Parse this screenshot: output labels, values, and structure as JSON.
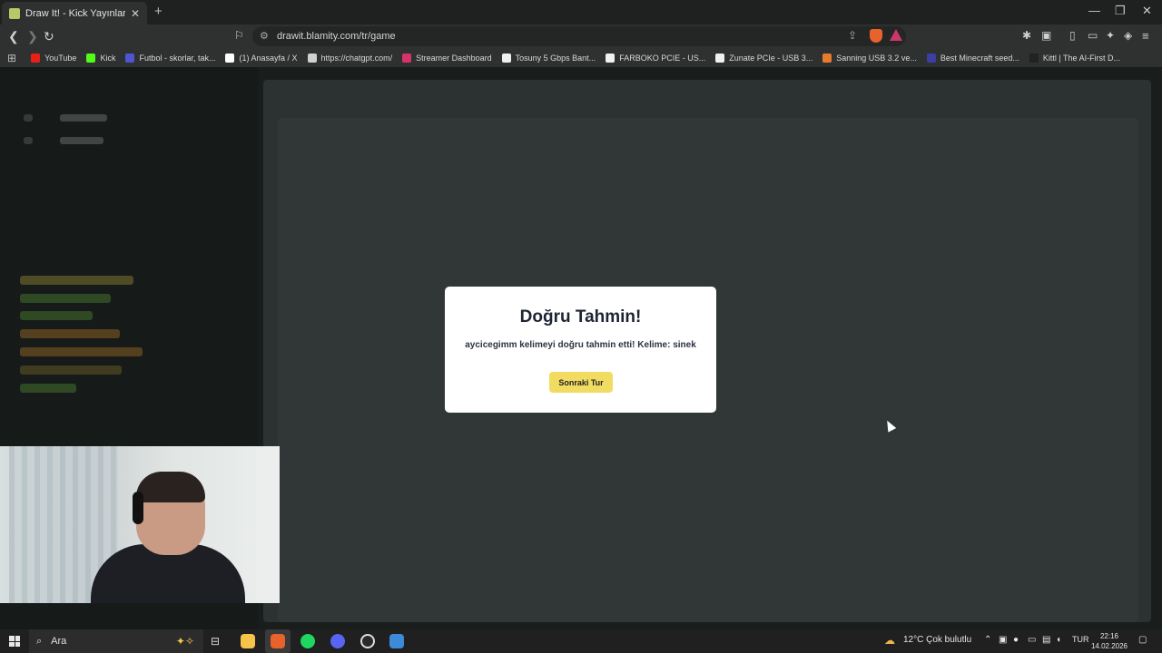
{
  "browser": {
    "tab_title": "Draw It! - Kick Yayınları İçin Çizim",
    "tab_close": "✕",
    "new_tab": "+",
    "url": "drawit.blamity.com/tr/game",
    "window_controls": [
      "—",
      "❐",
      "✕"
    ],
    "bookmarks": [
      {
        "label": "YouTube",
        "color": "#e62117"
      },
      {
        "label": "Kick",
        "color": "#53fc18"
      },
      {
        "label": "Futbol - skorlar, tak...",
        "color": "#4d55d1"
      },
      {
        "label": "(1) Anasayfa / X",
        "color": "#ffffff"
      },
      {
        "label": "https://chatgpt.com/",
        "color": "#d0d0d0"
      },
      {
        "label": "Streamer Dashboard",
        "color": "#d6336c"
      },
      {
        "label": "Tosuny 5 Gbps Bant...",
        "color": "#f0f0f0"
      },
      {
        "label": "FARBOKO PCIE - US...",
        "color": "#f0f0f0"
      },
      {
        "label": "Zunate PCIe - USB 3...",
        "color": "#f0f0f0"
      },
      {
        "label": "Sanning USB 3.2 ve...",
        "color": "#e87a2e"
      },
      {
        "label": "Best Minecraft seed...",
        "color": "#3a3fa0"
      },
      {
        "label": "Kittl | The AI-First D...",
        "color": "#222222"
      }
    ]
  },
  "modal": {
    "title": "Doğru Tahmin!",
    "message": "aycicegimm kelimeyi doğru tahmin etti! Kelime: sinek",
    "button": "Sonraki Tur"
  },
  "taskbar": {
    "search_placeholder": "Ara",
    "weather": "12°C  Çok bulutlu",
    "language": "TUR",
    "time": "22:16",
    "date": "14.02.2026"
  }
}
